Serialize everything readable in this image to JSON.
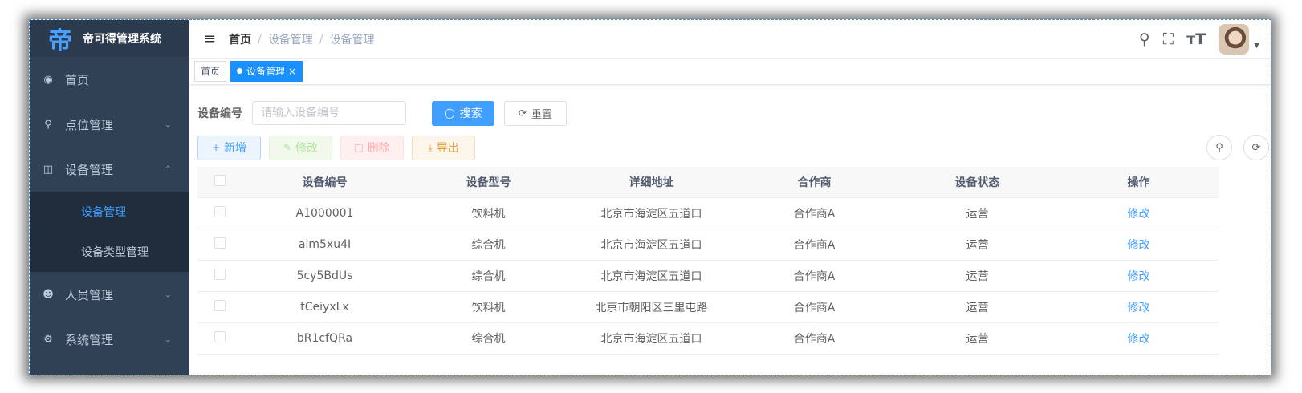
{
  "app": {
    "title": "帝可得管理系统",
    "logo_char": "帝"
  },
  "sidebar": {
    "items": [
      {
        "label": "首页",
        "icon": "dashboard-icon"
      },
      {
        "label": "点位管理",
        "icon": "location-icon",
        "expanded": false
      },
      {
        "label": "设备管理",
        "icon": "device-icon",
        "expanded": true
      },
      {
        "label": "人员管理",
        "icon": "people-icon",
        "expanded": false
      },
      {
        "label": "系统管理",
        "icon": "gear-icon",
        "expanded": false
      }
    ],
    "submenu": [
      {
        "label": "设备管理",
        "active": true
      },
      {
        "label": "设备类型管理",
        "active": false
      }
    ]
  },
  "navbar": {
    "breadcrumb": [
      "首页",
      "设备管理",
      "设备管理"
    ],
    "icons": [
      "search-icon",
      "fullscreen-icon",
      "font-size-icon"
    ]
  },
  "tags": [
    {
      "label": "首页",
      "active": false
    },
    {
      "label": "设备管理",
      "active": true
    }
  ],
  "search": {
    "label": "设备编号",
    "placeholder": "请输入设备编号",
    "search_button": "搜索",
    "reset_button": "重置"
  },
  "toolbar": {
    "add": "新增",
    "edit": "修改",
    "delete": "删除",
    "export": "导出"
  },
  "table": {
    "headers": [
      "设备编号",
      "设备型号",
      "详细地址",
      "合作商",
      "设备状态",
      "操作"
    ],
    "rows": [
      [
        "A1000001",
        "饮料机",
        "北京市海淀区五道口",
        "合作商A",
        "运营",
        "修改"
      ],
      [
        "aim5xu4I",
        "综合机",
        "北京市海淀区五道口",
        "合作商A",
        "运营",
        "修改"
      ],
      [
        "5cy5BdUs",
        "综合机",
        "北京市海淀区五道口",
        "合作商A",
        "运营",
        "修改"
      ],
      [
        "tCeiyxLx",
        "饮料机",
        "北京市朝阳区三里屯路",
        "合作商A",
        "运营",
        "修改"
      ],
      [
        "bR1cfQRa",
        "综合机",
        "北京市海淀区五道口",
        "合作商A",
        "运营",
        "修改"
      ]
    ]
  },
  "colors": {
    "sidebar_bg": "#304156",
    "primary": "#409eff",
    "active_menu": "#409eff"
  }
}
